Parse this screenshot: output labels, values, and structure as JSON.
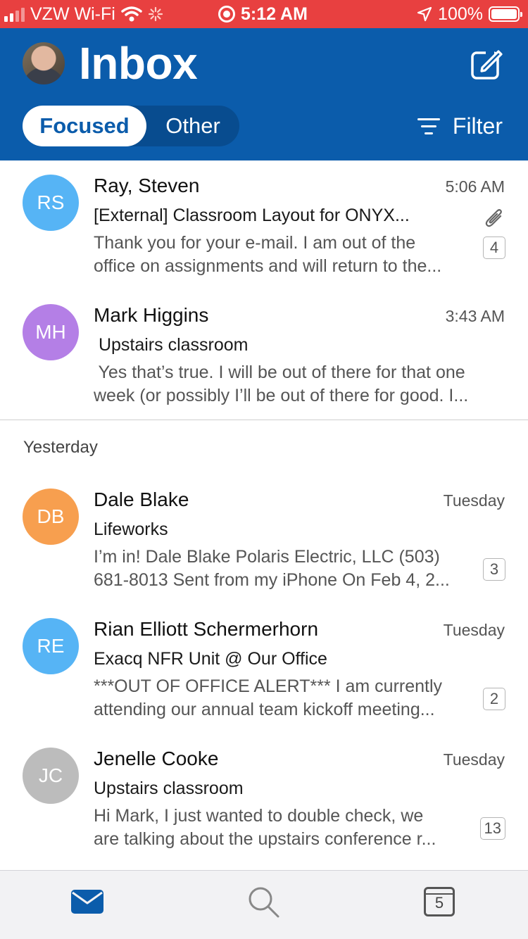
{
  "status_bar": {
    "carrier": "VZW Wi-Fi",
    "time": "5:12 AM",
    "battery": "100%",
    "battery_level": 1.0
  },
  "header": {
    "title": "Inbox",
    "tabs": {
      "focused": "Focused",
      "other": "Other"
    },
    "filter_label": "Filter"
  },
  "messages": [
    {
      "initials": "RS",
      "avatar_color": "#56b4f5",
      "sender": "Ray, Steven",
      "time": "5:06 AM",
      "subject": "[External] Classroom Layout for ONYX...",
      "preview_line1": "Thank you for your e-mail. I am out of the",
      "preview_line2": "office on assignments and will return to the...",
      "count": "4",
      "has_attachment": true
    },
    {
      "initials": "MH",
      "avatar_color": "#b47fe6",
      "sender": "Mark Higgins",
      "time": "3:43 AM",
      "subject": " Upstairs classroom",
      "preview_line1": " Yes that’s true. I will be out of there for that one",
      "preview_line2": "week (or possibly I’ll be out of there for good. I..."
    }
  ],
  "section_yesterday": "Yesterday",
  "yesterday_messages": [
    {
      "initials": "DB",
      "avatar_color": "#f79f4f",
      "sender": "Dale Blake",
      "time": "Tuesday",
      "subject": "Lifeworks",
      "preview_line1": "I’m in! Dale Blake Polaris Electric, LLC (503)",
      "preview_line2": "681-8013 Sent from my iPhone On Feb 4, 2...",
      "count": "3"
    },
    {
      "initials": "RE",
      "avatar_color": "#56b4f5",
      "sender": "Rian Elliott Schermerhorn",
      "time": "Tuesday",
      "subject": "Exacq NFR Unit @ Our Office",
      "preview_line1": "***OUT OF OFFICE ALERT*** I am currently",
      "preview_line2": "attending our annual team kickoff meeting...",
      "count": "2"
    },
    {
      "initials": "JC",
      "avatar_color": "#bcbcbc",
      "sender": "Jenelle Cooke",
      "time": "Tuesday",
      "subject": "Upstairs classroom",
      "preview_line1": "Hi Mark, I just wanted to double check, we",
      "preview_line2": "are talking about the upstairs conference r...",
      "count": "13"
    }
  ],
  "tabbar": {
    "mail_icon": "mail-icon",
    "search_icon": "search-icon",
    "calendar_day": "5"
  },
  "colors": {
    "header_bg": "#0b5cab",
    "status_bg": "#e84040",
    "accent": "#0b5cab"
  }
}
